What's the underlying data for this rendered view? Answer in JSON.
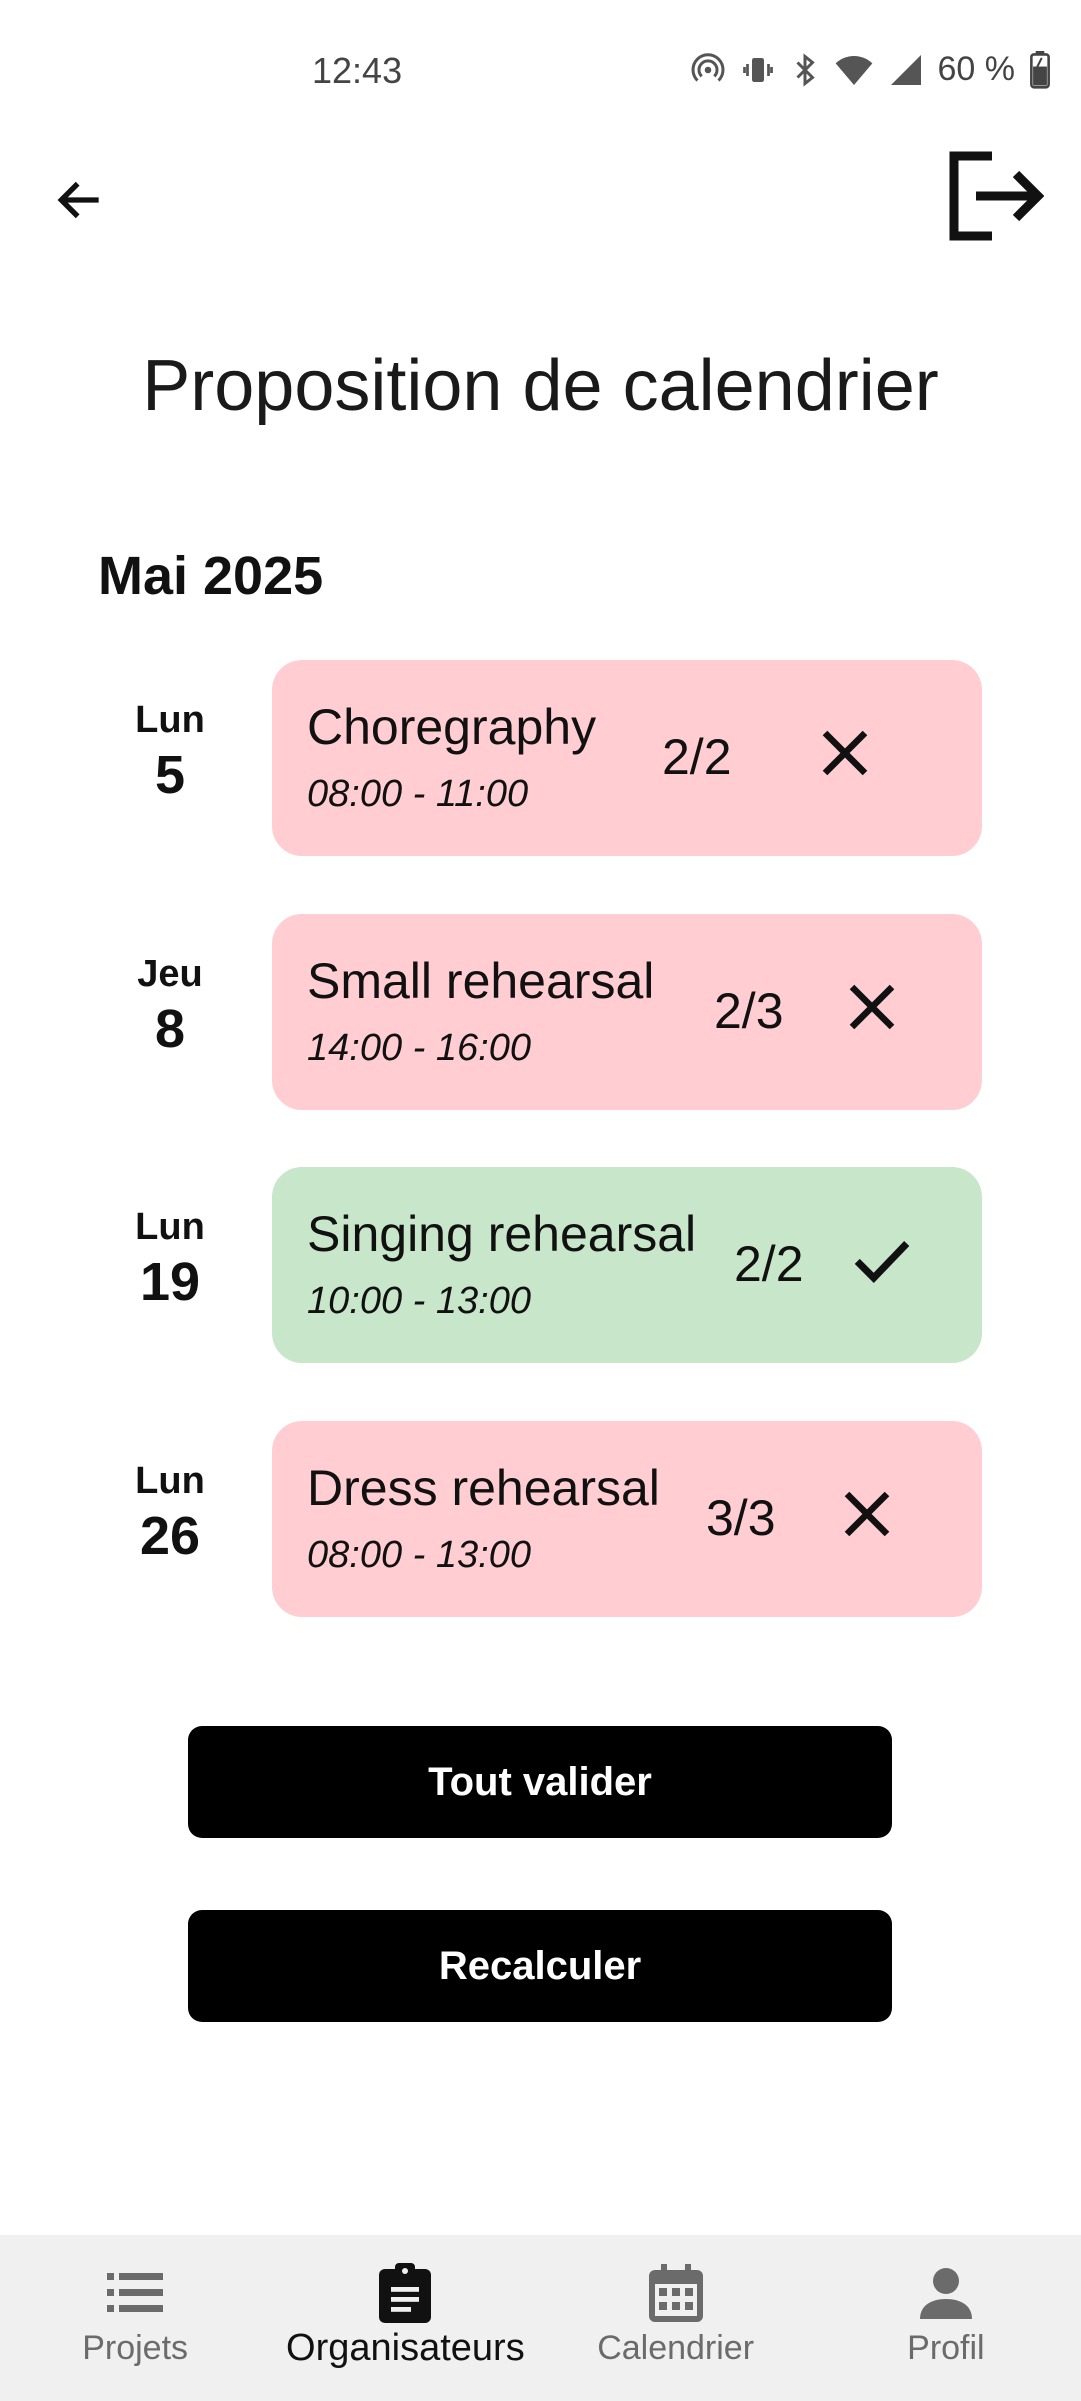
{
  "status_bar": {
    "time": "12:43",
    "battery": "60 %"
  },
  "header": {
    "back_icon": "arrow-left-icon",
    "logout_icon": "logout-icon"
  },
  "page": {
    "title": "Proposition de calendrier",
    "month": "Mai 2025"
  },
  "events": [
    {
      "day_name": "Lun",
      "day_num": "5",
      "name": "Choregraphy",
      "time": "08:00 - 11:00",
      "count": "2/2",
      "status": "rejected",
      "status_icon": "close-icon"
    },
    {
      "day_name": "Jeu",
      "day_num": "8",
      "name": "Small rehearsal",
      "time": "14:00 - 16:00",
      "count": "2/3",
      "status": "rejected",
      "status_icon": "close-icon"
    },
    {
      "day_name": "Lun",
      "day_num": "19",
      "name": "Singing rehearsal",
      "time": "10:00 - 13:00",
      "count": "2/2",
      "status": "accepted",
      "status_icon": "check-icon"
    },
    {
      "day_name": "Lun",
      "day_num": "26",
      "name": "Dress rehearsal",
      "time": "08:00 - 13:00",
      "count": "3/3",
      "status": "rejected",
      "status_icon": "close-icon"
    }
  ],
  "actions": {
    "validate_all": "Tout valider",
    "recalculate": "Recalculer"
  },
  "bottom_nav": [
    {
      "label": "Projets",
      "icon": "list-icon",
      "active": false
    },
    {
      "label": "Organisateurs",
      "icon": "clipboard-icon",
      "active": true
    },
    {
      "label": "Calendrier",
      "icon": "calendar-icon",
      "active": false
    },
    {
      "label": "Profil",
      "icon": "person-icon",
      "active": false
    }
  ],
  "colors": {
    "rejected": "#ffcdd2",
    "accepted": "#c8e6c9",
    "button": "#000000",
    "nav_background": "#f0f0f0"
  }
}
